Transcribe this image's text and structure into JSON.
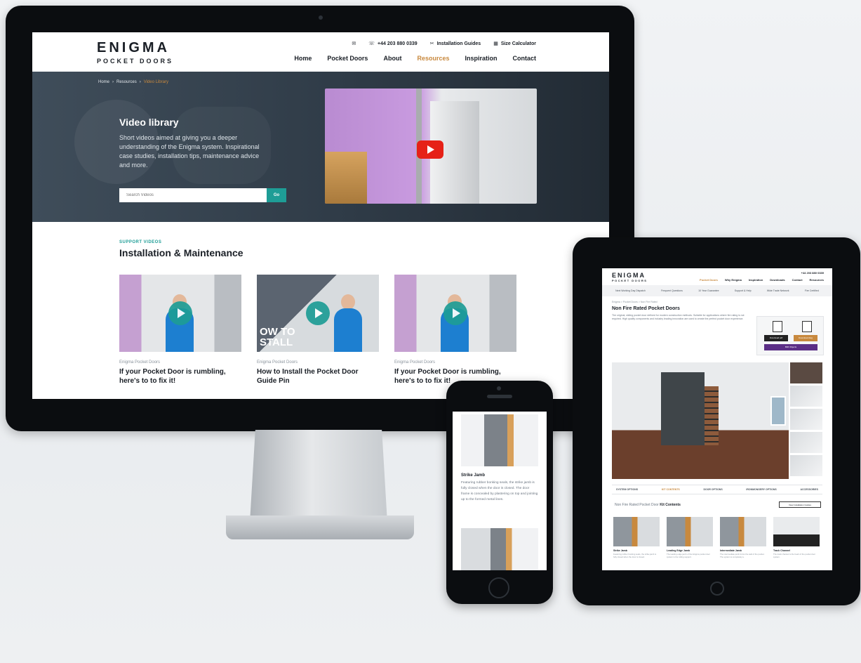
{
  "desktop": {
    "logo": {
      "main": "ENIGMA",
      "sub": "POCKET DOORS"
    },
    "utility": [
      {
        "icon": "mail-icon",
        "label": "✉"
      },
      {
        "icon": "phone-icon",
        "label": "+44 203 880 0339"
      },
      {
        "icon": "tools-icon",
        "label": "Installation Guides"
      },
      {
        "icon": "calculator-icon",
        "label": "Size Calculator"
      }
    ],
    "nav": [
      "Home",
      "Pocket Doors",
      "About",
      "Resources",
      "Inspiration",
      "Contact"
    ],
    "active_nav": "Resources",
    "breadcrumb": [
      "Home",
      "Resources",
      "Video Library"
    ],
    "hero": {
      "title_bold": "Video",
      "title_rest": " library",
      "text": "Short videos aimed at giving you a deeper understanding of the Enigma system. Inspirational case studies, installation tips, maintenance advice and more.",
      "search_placeholder": "Search Videos",
      "search_button": "Go"
    },
    "section": {
      "kicker": "SUPPORT VIDEOS",
      "title": "Installation & Maintenance"
    },
    "cards": [
      {
        "meta": "Enigma Pocket Doors",
        "title": "If your Pocket Door is rumbling, here's to to fix it!"
      },
      {
        "meta": "Enigma Pocket Doors",
        "title": "How to Install the Pocket Door Guide Pin",
        "overlay": "OW TO\nSTALL"
      },
      {
        "meta": "Enigma Pocket Doors",
        "title": "If your Pocket Door is rumbling, here's to to fix it!"
      }
    ]
  },
  "tablet": {
    "logo": {
      "main": "ENIGMA",
      "sub": "POCKET DOORS"
    },
    "phone": "+44 203 880 0339",
    "nav": [
      "Pocket Doors",
      "Why Enigma",
      "Inspiration",
      "Downloads",
      "Contact",
      "Resources"
    ],
    "active_nav": "Pocket Doors",
    "bar": [
      "Next Working Day Dispatch",
      "Frequent Questions",
      "10 Year Guarantee",
      "Support & Help",
      "Wide Trade Network",
      "Fire Certified"
    ],
    "breadcrumb": "Enigma > Pocket Doors > Non Fire Rated",
    "title": "Non Fire Rated Pocket Doors",
    "copy": "The original, sliding pocket door defined for modern construction methods. Suitable for applications where fire rating is not required. High quality components and industry leading innovation are used to create the perfect pocket door experience.",
    "download": {
      "pdf": "Download pdf",
      "dwg": "Download dwg",
      "bim": "BIM Objects"
    },
    "tabs": [
      "SYSTEM OPTIONS",
      "KIT CONTENTS",
      "DOOR OPTIONS",
      "IRONMONGERY OPTIONS",
      "ACCESSORIES"
    ],
    "kit_title_prefix": "Non Fire Rated Pocket Door ",
    "kit_title_bold": "Kit Contents",
    "kit_button": "View Installation Guides",
    "products": [
      {
        "name": "Strike Jamb",
        "text": "Featuring rubber bonking seals, the strike jamb is fully closed when the door is closed."
      },
      {
        "name": "Leading Edge Jamb",
        "text": "The leading edge jamb of the Enigma pocket door system is the rolling support."
      },
      {
        "name": "Intermediate Jamb",
        "text": "The intermediate jamb forms the wall of the pocket. The system is completely a."
      },
      {
        "name": "Track Channel",
        "text": "The track channel is the heart of the pocket door system."
      }
    ]
  },
  "phone": {
    "title": "Strike Jamb",
    "text": "Featuring rubber bonking seals, the strike jamb is fully closed when the door is closed. The door frame is concealed by plastering on top and jointing up to the formed metal lines."
  }
}
